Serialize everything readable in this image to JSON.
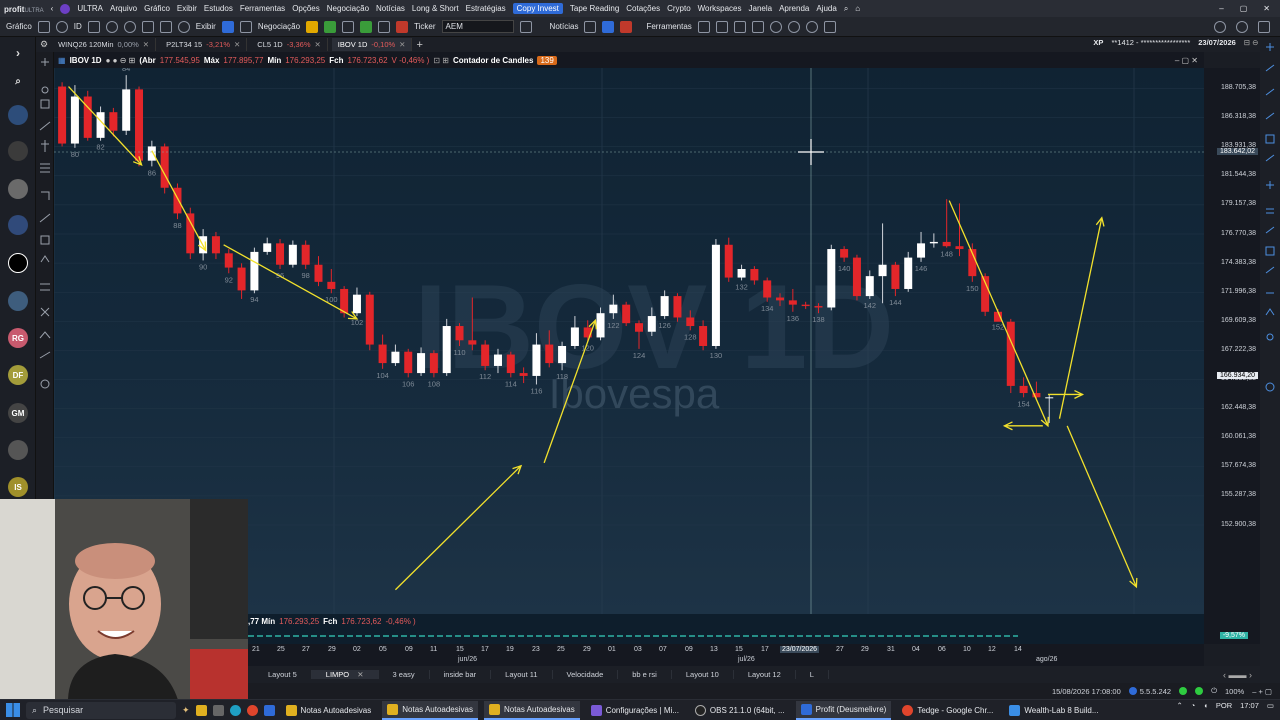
{
  "menu": {
    "logo": "profit",
    "logo_suffix": "ULTRA",
    "items": [
      "ULTRA",
      "Arquivo",
      "Gráfico",
      "Exibir",
      "Estudos",
      "Ferramentas",
      "Opções",
      "Negociação",
      "Notícias",
      "Long & Short",
      "Estratégias"
    ],
    "copy_invest": "Copy Invest",
    "items2": [
      "Tape Reading",
      "Cotações",
      "Crypto",
      "Workspaces",
      "Janela",
      "Aprenda",
      "Ajuda"
    ]
  },
  "toolbar": {
    "grafico": "Gráfico",
    "id": "ID",
    "exibir": "Exibir",
    "negociacao": "Negociação",
    "ticker_label": "Ticker",
    "ticker_value": "AEM",
    "noticias": "Notícias",
    "ferramentas": "Ferramentas"
  },
  "tabs": [
    {
      "label": "WINQ26 120Min",
      "pct": "0,00%"
    },
    {
      "label": "P2LT34 15",
      "pct": "-3,21%"
    },
    {
      "label": "CL5 1D",
      "pct": "-3,36%"
    },
    {
      "label": "IBOV 1D",
      "pct": "-0,10%",
      "active": true
    }
  ],
  "account": {
    "broker": "XP",
    "masked": "**1412 - *****************",
    "date": "23/07/2026"
  },
  "sidebar_avatars": [
    "RG",
    "DF",
    "GM",
    "IS"
  ],
  "chart_header": {
    "symbol": "IBOV 1D",
    "ohlc_prefix": "(Abr",
    "open": "177.545,95",
    "max_label": "Máx",
    "max": "177.895,77",
    "min_label": "Mín",
    "min": "176.293,25",
    "close_label": "Fch",
    "close": "176.723,62",
    "var": "V -0,46% )",
    "indicator": "Contador de Candles",
    "indicator_value": "139"
  },
  "lower_header": {
    "prefix": ",77 Mín",
    "min": "176.293,25",
    "fch": "Fch",
    "close": "176.723,62",
    "var": "-0,46% )"
  },
  "watermark": {
    "title": "IBOV 1D",
    "subtitle": "Ibovespa"
  },
  "price_axis": {
    "labels": [
      "188.705,38",
      "186.318,38",
      "183.931,38",
      "181.544,38",
      "179.157,38",
      "176.770,38",
      "174.383,38",
      "171.996,38",
      "169.609,38",
      "167.222,38",
      "164.835,38",
      "162.448,38",
      "160.061,38",
      "157.674,38",
      "155.287,38",
      "152.900,38"
    ],
    "crosshair": "183.642,02",
    "last": "166.934,20",
    "vol_tag": "-9,57%"
  },
  "time_axis": {
    "days": [
      "21",
      "25",
      "27",
      "29",
      "02",
      "05",
      "09",
      "11",
      "15",
      "17",
      "19",
      "23",
      "25",
      "29",
      "01",
      "03",
      "07",
      "09",
      "13",
      "15",
      "17",
      "23/07/2026",
      "27",
      "29",
      "31",
      "04",
      "06",
      "10",
      "12",
      "14"
    ],
    "months": [
      "jun/26",
      "jul/26",
      "ago/26"
    ]
  },
  "layouts": [
    "Layout 5",
    "LIMPO",
    "3 easy",
    "inside bar",
    "Layout 11",
    "Velocidade",
    "bb e rsi",
    "Layout 10",
    "Layout 12",
    "L"
  ],
  "status": {
    "datetime": "15/08/2026 17:08:00",
    "version": "5.5.5.242",
    "zoom": "100%"
  },
  "taskbar": {
    "search": "Pesquisar",
    "apps": [
      "Notas Autoadesivas",
      "Notas Autoadesivas",
      "Notas Autoadesivas",
      "Configurações | Mi...",
      "OBS 21.1.0 (64bit, ...",
      "Profit (Deusmelivre)",
      "Tedge - Google Chr...",
      "Wealth-Lab 8 Build..."
    ],
    "lang": "POR",
    "time": "17:07"
  },
  "chart_data": {
    "type": "candlestick",
    "symbol": "IBOV",
    "timeframe": "1D",
    "ylim": [
      151700,
      190000
    ],
    "candles": [
      {
        "n": 79,
        "o": 188700,
        "h": 189000,
        "l": 184500,
        "c": 184700
      },
      {
        "n": 80,
        "o": 184700,
        "h": 188800,
        "l": 184400,
        "c": 188000
      },
      {
        "n": 81,
        "o": 188000,
        "h": 188400,
        "l": 184900,
        "c": 185100
      },
      {
        "n": 82,
        "o": 185100,
        "h": 187300,
        "l": 184900,
        "c": 186900
      },
      {
        "n": 83,
        "o": 186900,
        "h": 187200,
        "l": 185200,
        "c": 185600
      },
      {
        "n": 84,
        "o": 185600,
        "h": 189500,
        "l": 185300,
        "c": 188500
      },
      {
        "n": 85,
        "o": 188500,
        "h": 188700,
        "l": 183100,
        "c": 183500
      },
      {
        "n": 86,
        "o": 183500,
        "h": 184900,
        "l": 183100,
        "c": 184500
      },
      {
        "n": 87,
        "o": 184500,
        "h": 184700,
        "l": 181200,
        "c": 181600
      },
      {
        "n": 88,
        "o": 181600,
        "h": 181900,
        "l": 179400,
        "c": 179800
      },
      {
        "n": 89,
        "o": 179800,
        "h": 180200,
        "l": 176600,
        "c": 177000
      },
      {
        "n": 90,
        "o": 177000,
        "h": 178700,
        "l": 176500,
        "c": 178200
      },
      {
        "n": 91,
        "o": 178200,
        "h": 178500,
        "l": 176600,
        "c": 177000
      },
      {
        "n": 92,
        "o": 177000,
        "h": 177300,
        "l": 175600,
        "c": 176000
      },
      {
        "n": 93,
        "o": 176000,
        "h": 176300,
        "l": 173800,
        "c": 174400
      },
      {
        "n": 94,
        "o": 174400,
        "h": 177400,
        "l": 174200,
        "c": 177100
      },
      {
        "n": 95,
        "o": 177100,
        "h": 178100,
        "l": 176900,
        "c": 177700
      },
      {
        "n": 96,
        "o": 177700,
        "h": 178000,
        "l": 175900,
        "c": 176200
      },
      {
        "n": 97,
        "o": 176200,
        "h": 177900,
        "l": 176000,
        "c": 177600
      },
      {
        "n": 98,
        "o": 177600,
        "h": 177900,
        "l": 175900,
        "c": 176200
      },
      {
        "n": 99,
        "o": 176200,
        "h": 176800,
        "l": 174700,
        "c": 175000
      },
      {
        "n": 100,
        "o": 175000,
        "h": 175900,
        "l": 174200,
        "c": 174500
      },
      {
        "n": 101,
        "o": 174500,
        "h": 174700,
        "l": 172500,
        "c": 172800
      },
      {
        "n": 102,
        "o": 172800,
        "h": 174600,
        "l": 172600,
        "c": 174100
      },
      {
        "n": 103,
        "o": 174100,
        "h": 174300,
        "l": 170200,
        "c": 170600
      },
      {
        "n": 104,
        "o": 170600,
        "h": 171300,
        "l": 168900,
        "c": 169300
      },
      {
        "n": 105,
        "o": 169300,
        "h": 170600,
        "l": 169100,
        "c": 170100
      },
      {
        "n": 106,
        "o": 170100,
        "h": 170300,
        "l": 168300,
        "c": 168600
      },
      {
        "n": 107,
        "o": 168600,
        "h": 170400,
        "l": 168400,
        "c": 170000
      },
      {
        "n": 108,
        "o": 170000,
        "h": 170200,
        "l": 168300,
        "c": 168600
      },
      {
        "n": 109,
        "o": 168600,
        "h": 172400,
        "l": 168400,
        "c": 171900
      },
      {
        "n": 110,
        "o": 171900,
        "h": 172100,
        "l": 170500,
        "c": 170900
      },
      {
        "n": 111,
        "o": 170900,
        "h": 173900,
        "l": 170200,
        "c": 170600
      },
      {
        "n": 112,
        "o": 170600,
        "h": 170900,
        "l": 168800,
        "c": 169100
      },
      {
        "n": 113,
        "o": 169100,
        "h": 170300,
        "l": 168600,
        "c": 169900
      },
      {
        "n": 114,
        "o": 169900,
        "h": 170100,
        "l": 168300,
        "c": 168600
      },
      {
        "n": 115,
        "o": 168600,
        "h": 169000,
        "l": 167900,
        "c": 168400
      },
      {
        "n": 116,
        "o": 168400,
        "h": 171400,
        "l": 167800,
        "c": 170600
      },
      {
        "n": 117,
        "o": 170600,
        "h": 171600,
        "l": 169000,
        "c": 169300
      },
      {
        "n": 118,
        "o": 169300,
        "h": 170800,
        "l": 168800,
        "c": 170500
      },
      {
        "n": 119,
        "o": 170500,
        "h": 172600,
        "l": 170300,
        "c": 171800
      },
      {
        "n": 120,
        "o": 171800,
        "h": 172300,
        "l": 170800,
        "c": 171100
      },
      {
        "n": 121,
        "o": 171100,
        "h": 173200,
        "l": 170900,
        "c": 172800
      },
      {
        "n": 122,
        "o": 172800,
        "h": 174100,
        "l": 172400,
        "c": 173400
      },
      {
        "n": 123,
        "o": 173400,
        "h": 173600,
        "l": 171900,
        "c": 172100
      },
      {
        "n": 124,
        "o": 172100,
        "h": 172300,
        "l": 170300,
        "c": 171500
      },
      {
        "n": 125,
        "o": 171500,
        "h": 173200,
        "l": 171200,
        "c": 172600
      },
      {
        "n": 126,
        "o": 172600,
        "h": 174400,
        "l": 172400,
        "c": 174000
      },
      {
        "n": 127,
        "o": 174000,
        "h": 174200,
        "l": 172200,
        "c": 172500
      },
      {
        "n": 128,
        "o": 172500,
        "h": 173000,
        "l": 171600,
        "c": 171900
      },
      {
        "n": 129,
        "o": 171900,
        "h": 172300,
        "l": 170200,
        "c": 170500
      },
      {
        "n": 130,
        "o": 170500,
        "h": 178000,
        "l": 170300,
        "c": 177600
      },
      {
        "n": 131,
        "o": 177600,
        "h": 178100,
        "l": 175000,
        "c": 175300
      },
      {
        "n": 132,
        "o": 175300,
        "h": 176200,
        "l": 175100,
        "c": 175900
      },
      {
        "n": 133,
        "o": 175900,
        "h": 176100,
        "l": 174800,
        "c": 175100
      },
      {
        "n": 134,
        "o": 175100,
        "h": 175300,
        "l": 173600,
        "c": 173900
      },
      {
        "n": 135,
        "o": 173900,
        "h": 174200,
        "l": 173300,
        "c": 173700
      },
      {
        "n": 136,
        "o": 173700,
        "h": 174500,
        "l": 172900,
        "c": 173400
      },
      {
        "n": 137,
        "o": 173400,
        "h": 173600,
        "l": 173100,
        "c": 173300
      },
      {
        "n": 138,
        "o": 173300,
        "h": 173500,
        "l": 172800,
        "c": 173200
      },
      {
        "n": 139,
        "o": 173200,
        "h": 177600,
        "l": 173000,
        "c": 177300
      },
      {
        "n": 140,
        "o": 177300,
        "h": 177500,
        "l": 176400,
        "c": 176700
      },
      {
        "n": 141,
        "o": 176700,
        "h": 176900,
        "l": 173700,
        "c": 174000
      },
      {
        "n": 142,
        "o": 174000,
        "h": 175800,
        "l": 173800,
        "c": 175400
      },
      {
        "n": 143,
        "o": 175400,
        "h": 179100,
        "l": 173500,
        "c": 176200
      },
      {
        "n": 144,
        "o": 176200,
        "h": 176400,
        "l": 174000,
        "c": 174500
      },
      {
        "n": 145,
        "o": 174500,
        "h": 177100,
        "l": 174300,
        "c": 176700
      },
      {
        "n": 146,
        "o": 176700,
        "h": 178500,
        "l": 176400,
        "c": 177700
      },
      {
        "n": 147,
        "o": 177700,
        "h": 178400,
        "l": 177400,
        "c": 177800
      },
      {
        "n": 148,
        "o": 177800,
        "h": 180800,
        "l": 177400,
        "c": 177500
      },
      {
        "n": 149,
        "o": 177500,
        "h": 180500,
        "l": 176800,
        "c": 177300
      },
      {
        "n": 150,
        "o": 177300,
        "h": 177700,
        "l": 175000,
        "c": 175400
      },
      {
        "n": 151,
        "o": 175400,
        "h": 175600,
        "l": 172600,
        "c": 172900
      },
      {
        "n": 152,
        "o": 172900,
        "h": 173100,
        "l": 172300,
        "c": 172200
      },
      {
        "n": 153,
        "o": 172200,
        "h": 172400,
        "l": 167200,
        "c": 167700
      },
      {
        "n": 154,
        "o": 167700,
        "h": 168300,
        "l": 166900,
        "c": 167200
      },
      {
        "n": 155,
        "o": 167200,
        "h": 168000,
        "l": 166700,
        "c": 166900
      },
      {
        "n": 156,
        "o": 166900,
        "h": 167100,
        "l": 165100,
        "c": 166900
      }
    ],
    "candle_labels": [
      {
        "n": 80,
        "text": "80",
        "pos": "below"
      },
      {
        "n": 82,
        "text": "82",
        "pos": "below"
      },
      {
        "n": 84,
        "text": "84",
        "pos": "above"
      },
      {
        "n": 86,
        "text": "86",
        "pos": "below"
      },
      {
        "n": 88,
        "text": "88",
        "pos": "below"
      },
      {
        "n": 90,
        "text": "90",
        "pos": "below"
      },
      {
        "n": 92,
        "text": "92",
        "pos": "below"
      },
      {
        "n": 94,
        "text": "94",
        "pos": "below"
      },
      {
        "n": 96,
        "text": "96",
        "pos": "below"
      },
      {
        "n": 98,
        "text": "98",
        "pos": "below"
      },
      {
        "n": 100,
        "text": "100",
        "pos": "below"
      },
      {
        "n": 102,
        "text": "102",
        "pos": "below"
      },
      {
        "n": 104,
        "text": "104",
        "pos": "below"
      },
      {
        "n": 106,
        "text": "106",
        "pos": "below"
      },
      {
        "n": 108,
        "text": "108",
        "pos": "below"
      },
      {
        "n": 110,
        "text": "110",
        "pos": "below"
      },
      {
        "n": 112,
        "text": "112",
        "pos": "below"
      },
      {
        "n": 114,
        "text": "114",
        "pos": "below"
      },
      {
        "n": 116,
        "text": "116",
        "pos": "below"
      },
      {
        "n": 118,
        "text": "118",
        "pos": "below"
      },
      {
        "n": 120,
        "text": "120",
        "pos": "below"
      },
      {
        "n": 122,
        "text": "122",
        "pos": "below"
      },
      {
        "n": 124,
        "text": "124",
        "pos": "below"
      },
      {
        "n": 126,
        "text": "126",
        "pos": "below"
      },
      {
        "n": 128,
        "text": "128",
        "pos": "below"
      },
      {
        "n": 130,
        "text": "130",
        "pos": "below"
      },
      {
        "n": 132,
        "text": "132",
        "pos": "below"
      },
      {
        "n": 134,
        "text": "134",
        "pos": "below"
      },
      {
        "n": 136,
        "text": "136",
        "pos": "below"
      },
      {
        "n": 138,
        "text": "138",
        "pos": "below"
      },
      {
        "n": 140,
        "text": "140",
        "pos": "below"
      },
      {
        "n": 142,
        "text": "142",
        "pos": "below"
      },
      {
        "n": 144,
        "text": "144",
        "pos": "below"
      },
      {
        "n": 146,
        "text": "146",
        "pos": "below"
      },
      {
        "n": 148,
        "text": "148",
        "pos": "below"
      },
      {
        "n": 150,
        "text": "150",
        "pos": "below"
      },
      {
        "n": 152,
        "text": "152",
        "pos": "below"
      },
      {
        "n": 154,
        "text": "154",
        "pos": "below"
      }
    ],
    "annotations": [
      {
        "type": "arrow",
        "from": [
          79.5,
          188700
        ],
        "to": [
          85.2,
          183200
        ]
      },
      {
        "type": "arrow",
        "from": [
          86.0,
          184200
        ],
        "to": [
          90.2,
          177200
        ]
      },
      {
        "type": "arrow",
        "from": [
          91.6,
          177600
        ],
        "to": [
          102.0,
          172400
        ]
      },
      {
        "type": "arrow",
        "from": [
          105.0,
          153400
        ],
        "to": [
          114.8,
          162100
        ]
      },
      {
        "type": "arrow",
        "from": [
          116.6,
          162300
        ],
        "to": [
          120.6,
          172300
        ]
      },
      {
        "type": "arrow",
        "from": [
          148.2,
          180700
        ],
        "to": [
          155.9,
          164900
        ]
      },
      {
        "type": "arrow",
        "from": [
          155.9,
          167100
        ],
        "to": [
          158.6,
          167100
        ]
      },
      {
        "type": "arrow",
        "from": [
          155.5,
          164900
        ],
        "to": [
          152.5,
          164900
        ]
      },
      {
        "type": "arrow",
        "from": [
          156.8,
          165400
        ],
        "to": [
          160.1,
          179500
        ]
      },
      {
        "type": "arrow",
        "from": [
          157.4,
          164900
        ],
        "to": [
          162.8,
          153600
        ]
      }
    ]
  }
}
